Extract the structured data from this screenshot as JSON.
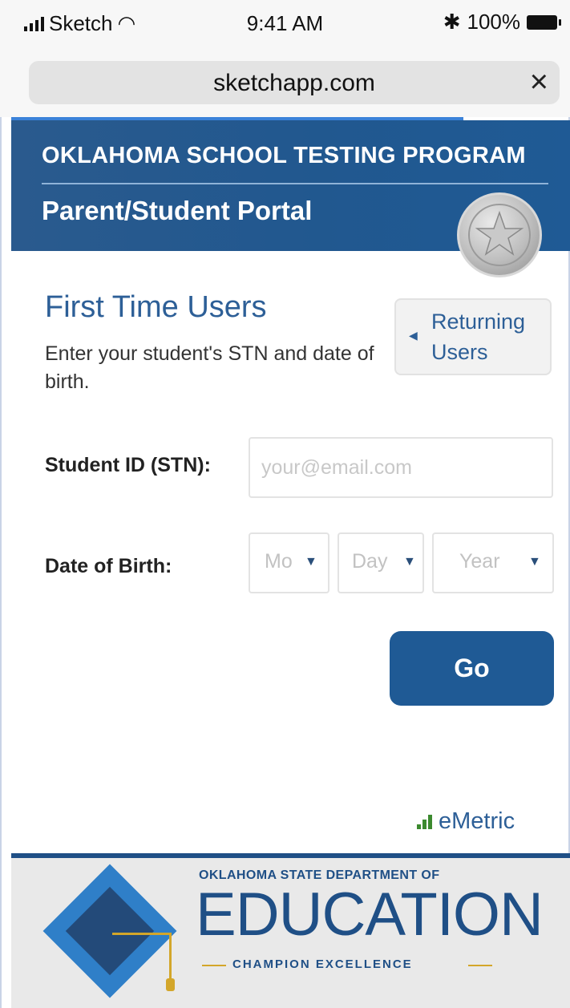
{
  "status_bar": {
    "carrier": "Sketch",
    "time": "9:41 AM",
    "battery": "100%"
  },
  "browser": {
    "url": "sketchapp.com",
    "close": "×"
  },
  "header": {
    "program": "OKLAHOMA SCHOOL TESTING PROGRAM",
    "portal": "Parent/Student Portal"
  },
  "main": {
    "title": "First Time Users",
    "description": "Enter your student's STN and date of birth.",
    "returning_button": "Returning Users",
    "stn_label": "Student ID (STN):",
    "stn_placeholder": "your@email.com",
    "dob_label": "Date of Birth:",
    "dob": {
      "month": "Mo",
      "day": "Day",
      "year": "Year"
    },
    "go_button": "Go"
  },
  "brand": {
    "vendor": "eMetric"
  },
  "footer": {
    "dept": "OKLAHOMA STATE DEPARTMENT OF",
    "education": "EDUCATION",
    "tagline": "CHAMPION EXCELLENCE"
  },
  "colors": {
    "accent": "#1f5a95",
    "link": "#2d5f97",
    "gold": "#d3a62a"
  }
}
